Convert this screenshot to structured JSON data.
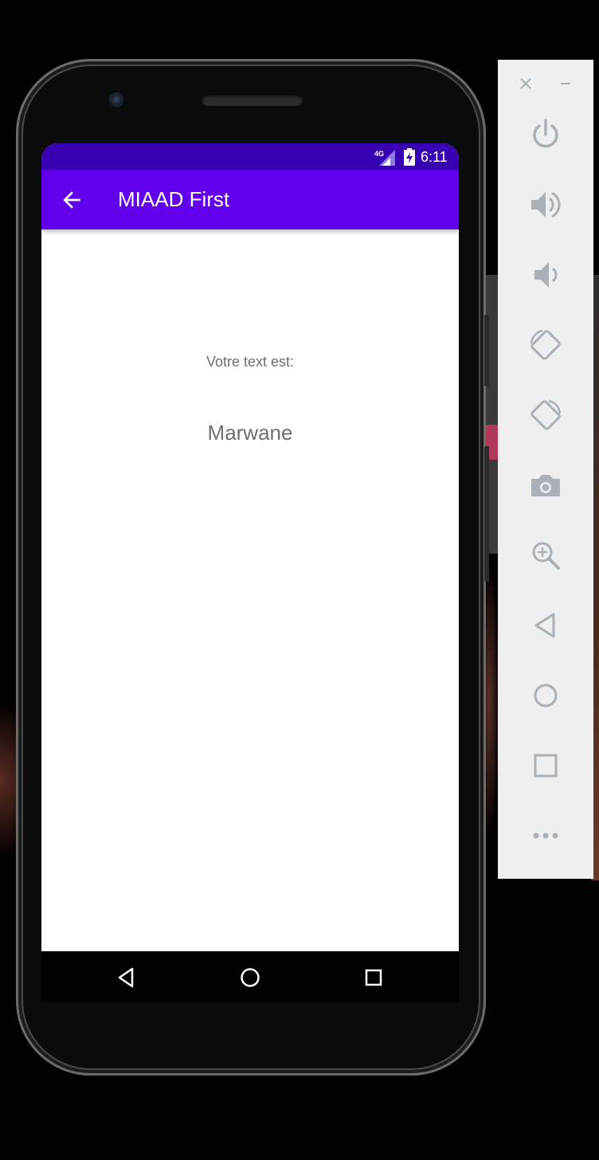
{
  "status_bar": {
    "network": "4G",
    "time": "6:11"
  },
  "app_bar": {
    "title": "MIAAD First",
    "back_icon": "arrow-back-icon"
  },
  "content": {
    "label": "Votre text est:",
    "value": "Marwane"
  },
  "navigation_bar": {
    "items": [
      "back-triangle-icon",
      "home-circle-icon",
      "recents-square-icon"
    ]
  },
  "emulator_panel": {
    "window_controls": [
      "close-icon",
      "minimize-icon"
    ],
    "tools": [
      "power-icon",
      "volume-up-icon",
      "volume-down-icon",
      "rotate-left-icon",
      "rotate-right-icon",
      "camera-icon",
      "zoom-icon",
      "back-icon",
      "home-icon",
      "overview-icon",
      "more-icon"
    ]
  },
  "colors": {
    "status_bar": "#3700b3",
    "app_bar": "#6200ee",
    "text_gray": "#6f6f6f",
    "panel_bg": "#efefef",
    "panel_icon": "#a9b0b8"
  }
}
